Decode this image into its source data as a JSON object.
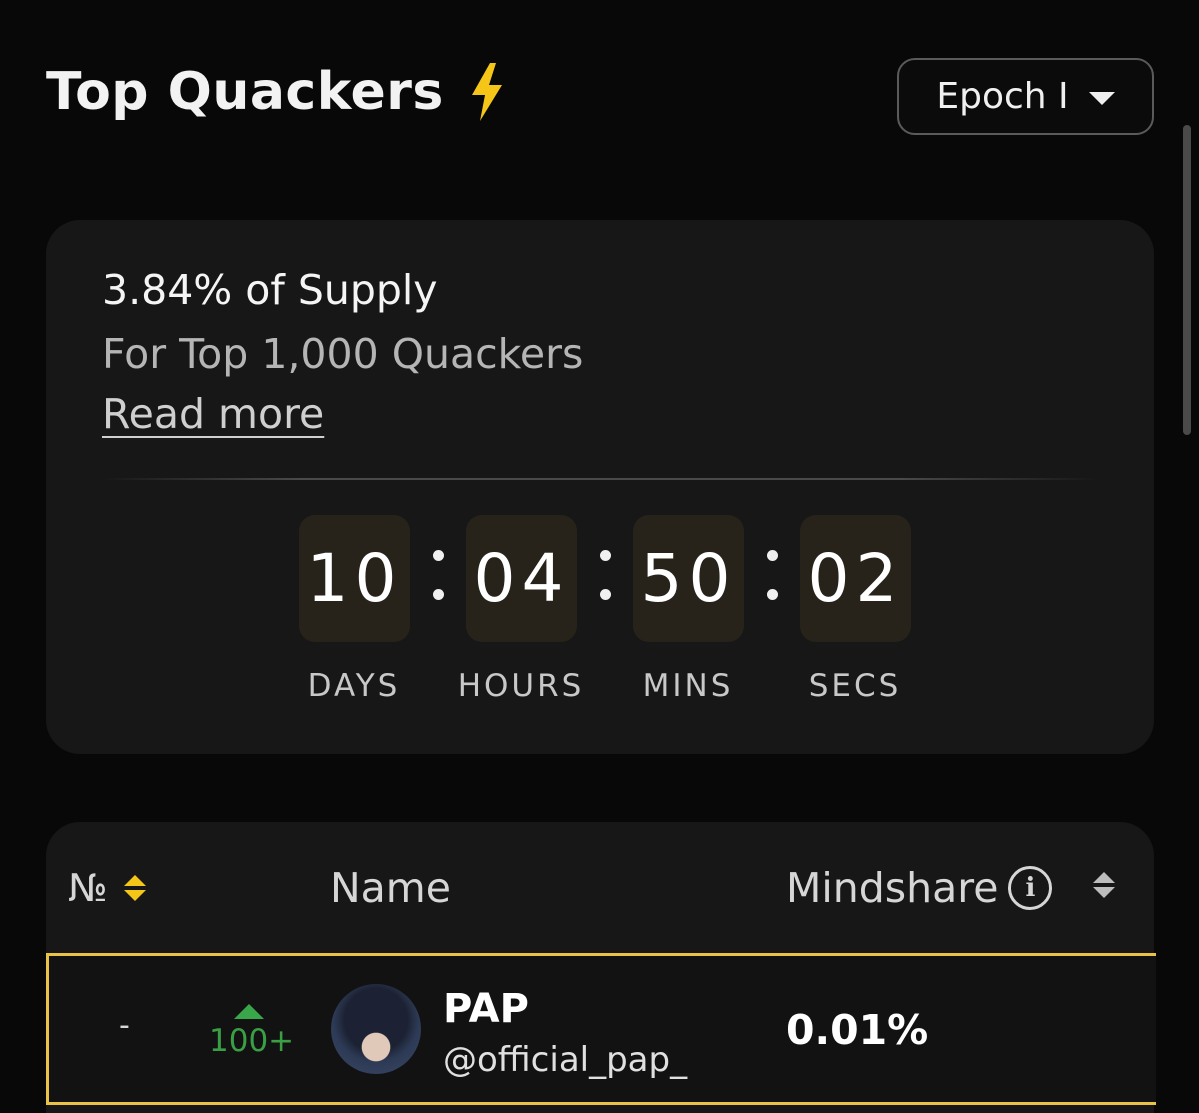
{
  "header": {
    "title": "Top Quackers",
    "title_icon": "lightning-bolt-icon",
    "accent": "#f5c518"
  },
  "epoch_select": {
    "value": "Epoch I"
  },
  "supply_card": {
    "title": "3.84% of Supply",
    "subtitle": "For Top 1,000 Quackers",
    "read_more": "Read more",
    "countdown": [
      {
        "value": "10",
        "label": "DAYS"
      },
      {
        "value": "04",
        "label": "HOURS"
      },
      {
        "value": "50",
        "label": "MINS"
      },
      {
        "value": "02",
        "label": "SECS"
      }
    ],
    "separator": ":"
  },
  "table": {
    "columns": {
      "rank": "№",
      "name": "Name",
      "mindshare": "Mindshare"
    },
    "rows": [
      {
        "rank": "-",
        "change": "100+",
        "name": "PAP",
        "handle": "@official_pap_",
        "mindshare": "0.01%"
      }
    ],
    "highlight_color": "#e8c347",
    "positive_color": "#3aa64a"
  }
}
